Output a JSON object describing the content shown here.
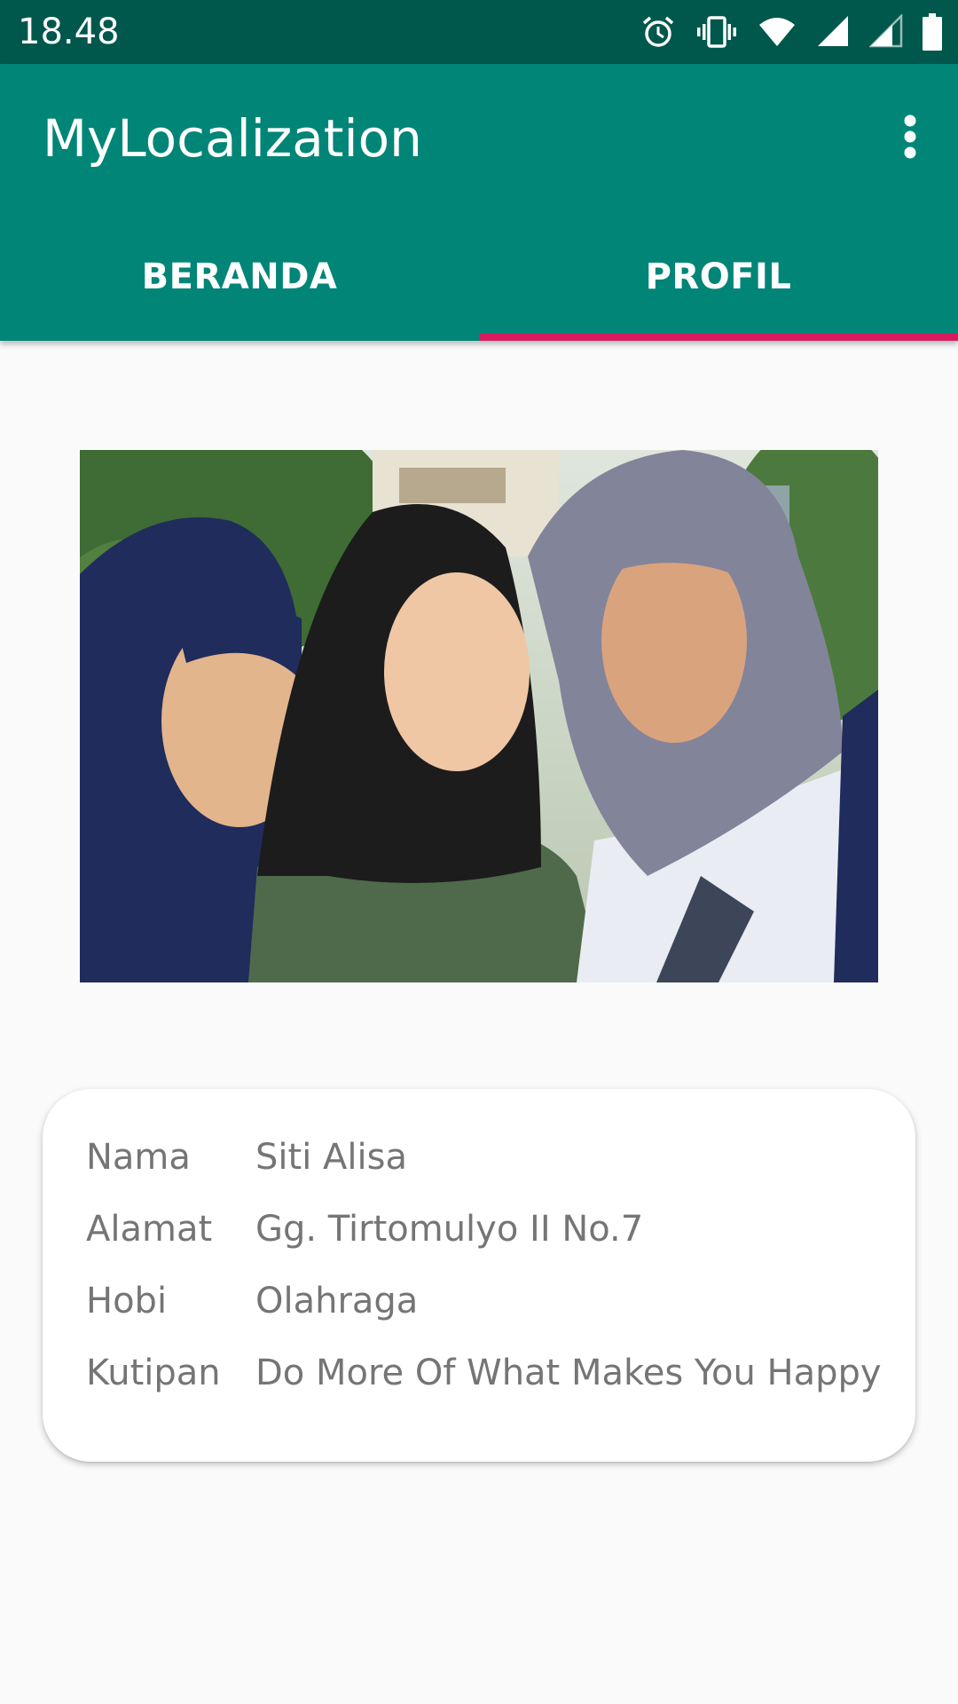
{
  "status_bar": {
    "time": "18.48",
    "icons": [
      "alarm-icon",
      "vibrate-icon",
      "wifi-icon",
      "signal-icon",
      "signal-icon",
      "battery-icon"
    ]
  },
  "app_bar": {
    "title": "MyLocalization",
    "overflow_icon": "more-vert-icon"
  },
  "tabs": [
    {
      "label": "BERANDA",
      "selected": false
    },
    {
      "label": "PROFIL",
      "selected": true
    }
  ],
  "colors": {
    "status_bar": "#00574b",
    "primary": "#008577",
    "accent": "#d81b60",
    "background": "#fafafa",
    "card": "#ffffff",
    "text": "#757575"
  },
  "profile": {
    "photo_icon": "profile-photo",
    "rows": [
      {
        "label": "Nama",
        "value": "Siti Alisa"
      },
      {
        "label": "Alamat",
        "value": "Gg. Tirtomulyo II No.7"
      },
      {
        "label": "Hobi",
        "value": "Olahraga"
      },
      {
        "label": "Kutipan",
        "value": "Do More Of What Makes You Happy"
      }
    ]
  }
}
